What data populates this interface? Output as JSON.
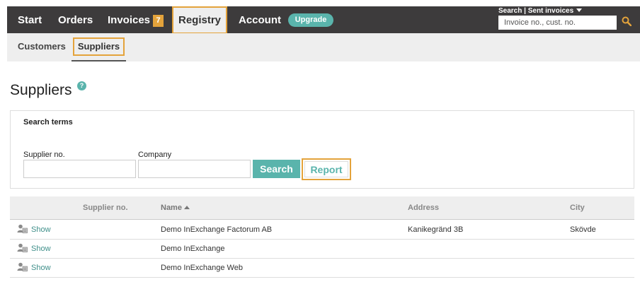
{
  "nav": {
    "start": "Start",
    "orders": "Orders",
    "invoices": "Invoices",
    "invoices_badge": "7",
    "registry": "Registry",
    "account": "Account",
    "upgrade": "Upgrade"
  },
  "quick_search": {
    "toggle_label": "Search | Sent invoices",
    "placeholder": "Invoice no., cust. no."
  },
  "subnav": {
    "customers": "Customers",
    "suppliers": "Suppliers"
  },
  "page": {
    "title": "Suppliers",
    "help_glyph": "?"
  },
  "search_panel": {
    "heading": "Search terms",
    "supplier_no_label": "Supplier no.",
    "supplier_no_value": "",
    "company_label": "Company",
    "company_value": "",
    "search_button": "Search",
    "report_button": "Report"
  },
  "table": {
    "columns": {
      "supplier_no": "Supplier no.",
      "name": "Name",
      "address": "Address",
      "city": "City"
    },
    "sort": "name-ascending",
    "rows": [
      {
        "action": "Show",
        "supplier_no": "",
        "name": "Demo InExchange Factorum AB",
        "address": "Kanikegränd 3B",
        "city": "Skövde"
      },
      {
        "action": "Show",
        "supplier_no": "",
        "name": "Demo InExchange",
        "address": "",
        "city": ""
      },
      {
        "action": "Show",
        "supplier_no": "",
        "name": "Demo InExchange Web",
        "address": "",
        "city": ""
      }
    ]
  },
  "colors": {
    "topbar": "#3d3b3c",
    "accent_teal": "#5ab4ac",
    "highlight_orange": "#e4a33b",
    "subbar": "#eeeeee"
  },
  "icons": {
    "search": "magnifier-icon",
    "row_action": "user-card-icon",
    "help": "question-icon",
    "dropdown": "caret-down-icon",
    "sort": "sort-up-icon"
  }
}
